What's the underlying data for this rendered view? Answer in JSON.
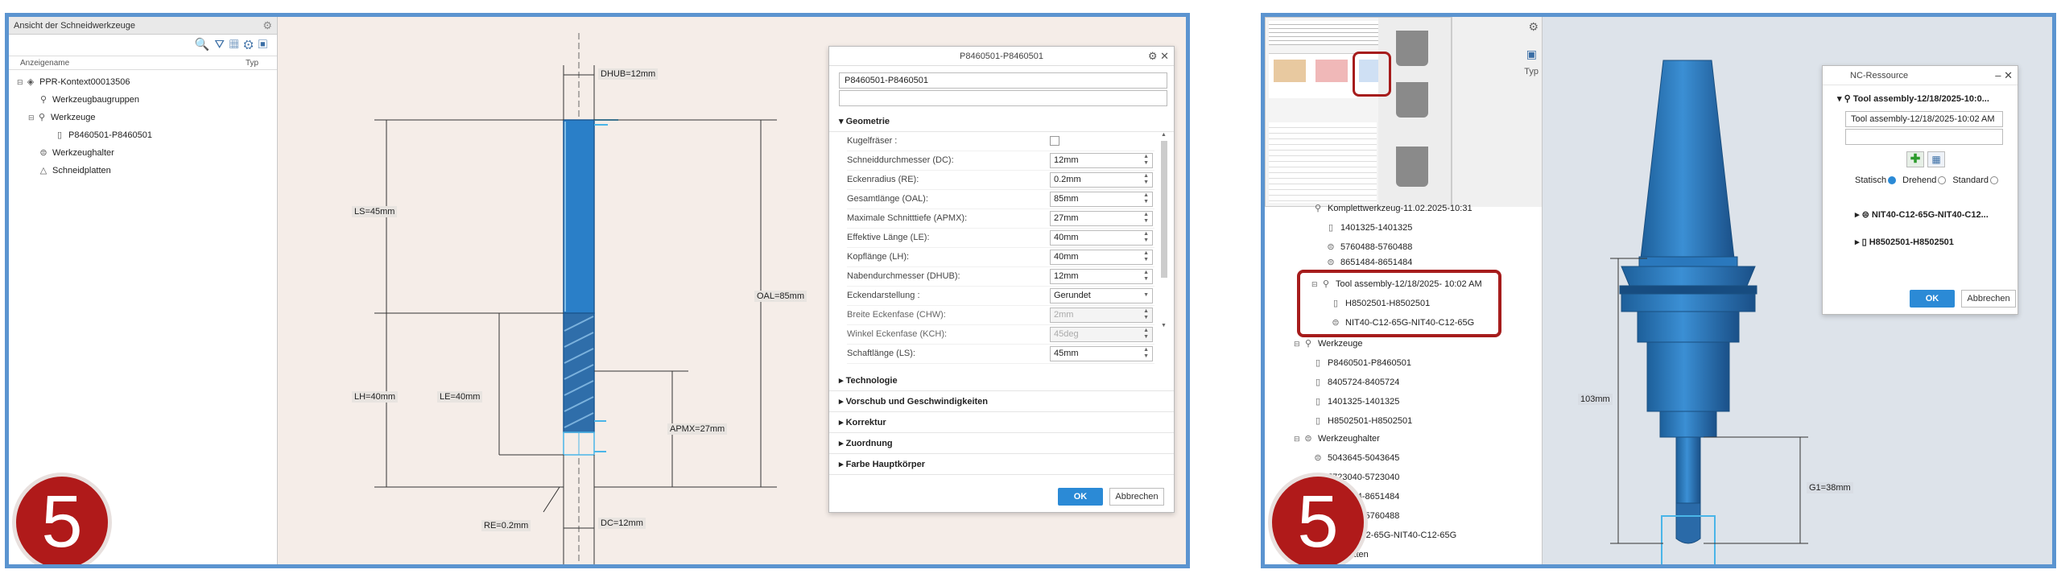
{
  "badge": "5",
  "left": {
    "tree": {
      "title": "Ansicht der Schneidwerkzeuge",
      "col_name": "Anzeigename",
      "col_type": "Typ",
      "nodes": [
        "PPR-Kontext00013506",
        "Werkzeugbaugruppen",
        "Werkzeuge",
        "P8460501-P8460501",
        "Werkzeughalter",
        "Schneidplatten"
      ]
    },
    "dims": {
      "dhub": "DHUB=12mm",
      "ls": "LS=45mm",
      "oal": "OAL=85mm",
      "lh": "LH=40mm",
      "le": "LE=40mm",
      "apmx": "APMX=27mm",
      "re": "RE=0.2mm",
      "dc": "DC=12mm"
    },
    "dialog": {
      "title": "P8460501-P8460501",
      "name_value": "P8460501-P8460501",
      "section_geometry": "Geometrie",
      "props": [
        {
          "label": "Kugelfräser :",
          "value": "",
          "type": "check"
        },
        {
          "label": "Schneiddurchmesser (DC):",
          "value": "12mm",
          "type": "spin"
        },
        {
          "label": "Eckenradius (RE):",
          "value": "0.2mm",
          "type": "spin"
        },
        {
          "label": "Gesamtlänge (OAL):",
          "value": "85mm",
          "type": "spin"
        },
        {
          "label": "Maximale Schnitttiefe (APMX):",
          "value": "27mm",
          "type": "spin"
        },
        {
          "label": "Effektive Länge (LE):",
          "value": "40mm",
          "type": "spin"
        },
        {
          "label": "Kopflänge (LH):",
          "value": "40mm",
          "type": "spin"
        },
        {
          "label": "Nabendurchmesser (DHUB):",
          "value": "12mm",
          "type": "spin"
        },
        {
          "label": "Eckendarstellung :",
          "value": "Gerundet",
          "type": "select"
        },
        {
          "label": "Breite Eckenfase (CHW):",
          "value": "2mm",
          "type": "gray"
        },
        {
          "label": "Winkel Eckenfase (KCH):",
          "value": "45deg",
          "type": "gray"
        },
        {
          "label": "Schaftlänge (LS):",
          "value": "45mm",
          "type": "spin"
        }
      ],
      "sections": [
        "Technologie",
        "Vorschub und Geschwindigkeiten",
        "Korrektur",
        "Zuordnung",
        "Farbe Hauptkörper"
      ],
      "ok": "OK",
      "cancel": "Abbrechen"
    }
  },
  "right": {
    "typ": "Typ",
    "tree": {
      "top": "Komplettwerkzeug-11.02.2025-10:31",
      "n1": "1401325-1401325",
      "n2": "5760488-5760488",
      "n3": "8651484-8651484",
      "assembly": "Tool assembly-12/18/2025- 10:02 AM",
      "a1": "H8502501-H8502501",
      "a2": "NIT40-C12-65G-NIT40-C12-65G",
      "werkzeuge": "Werkzeuge",
      "w": [
        "P8460501-P8460501",
        "8405724-8405724",
        "1401325-1401325",
        "H8502501-H8502501"
      ],
      "werkzeughalter": "Werkzeughalter",
      "h": [
        "5043645-5043645",
        "5723040-5723040",
        "8651484-8651484",
        "5760488-5760488",
        "NIT40-C12-65G-NIT40-C12-65G"
      ],
      "schneidplatten": "Schneidplatten"
    },
    "dims": {
      "h103": "103mm",
      "g1": "G1=38mm"
    },
    "dialog": {
      "title": "NC-Ressource",
      "root": "Tool assembly-12/18/2025-10:0...",
      "name_value": "Tool assembly-12/18/2025-10:02 AM",
      "radios": [
        "Statisch",
        "Drehend",
        "Standard"
      ],
      "child1": "NIT40-C12-65G-NIT40-C12...",
      "child2": "H8502501-H8502501",
      "ok": "OK",
      "cancel": "Abbrechen"
    }
  }
}
